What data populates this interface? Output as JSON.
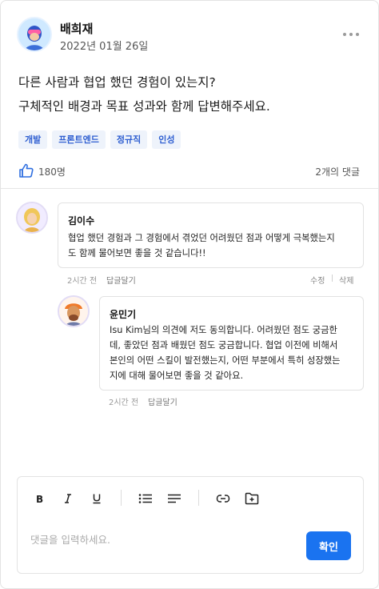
{
  "post": {
    "author": "배희재",
    "date": "2022년 01월 26일",
    "question_line1": "다른 사람과 협업 했던 경험이 있는지?",
    "question_line2": "구체적인 배경과 목표 성과와 함께 답변해주세요.",
    "tags": [
      "개발",
      "프론트엔드",
      "정규직",
      "인성"
    ],
    "likes": "180명",
    "comment_count": "2개의 댓글"
  },
  "comments": [
    {
      "author": "김이수",
      "text_line1": "협업 했던 경험과 그 경험에서 겪었던 어려웠던 점과 어떻게 극복했는지",
      "text_line2": "도 함께 물어보면 좋을 것 같습니다!!",
      "time": "2시간 전",
      "reply_label": "답글달기",
      "edit_label": "수정",
      "delete_label": "삭제"
    },
    {
      "author": "윤민기",
      "text_line1": "Isu Kim님의 의견에 저도 동의합니다. 어려웠던 점도 궁금한",
      "text_line2": "데, 좋았던 점과 배웠던 점도 궁금합니다. 협업 이전에 비해서",
      "text_line3": "본인의 어떤 스킬이 발전했는지, 어떤 부분에서 특히 성장했는",
      "text_line4": "지에 대해 물어보면 좋을 것 같아요.",
      "time": "2시간 전",
      "reply_label": "답글달기"
    }
  ],
  "editor": {
    "toolbar_icons": [
      "bold-icon",
      "italic-icon",
      "underline-icon",
      "bullet-list-icon",
      "align-icon",
      "link-icon",
      "folder-add-icon"
    ],
    "placeholder": "댓글을 입력하세요.",
    "submit_label": "확인"
  },
  "colors": {
    "accent": "#1a73f0",
    "tag_bg": "#eef3fb",
    "tag_text": "#2f5fd1"
  }
}
